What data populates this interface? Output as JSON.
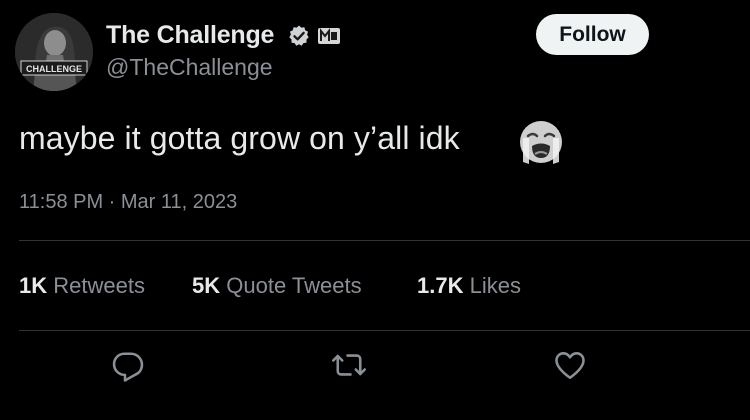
{
  "account": {
    "display_name": "The Challenge",
    "handle": "@TheChallenge",
    "avatar_text": "CHALLENGE",
    "verified_icon": "verified-badge-icon",
    "affiliate_icon": "affiliate-badge-icon"
  },
  "follow_button": {
    "label": "Follow"
  },
  "tweet": {
    "text": "maybe it gotta grow on y’all idk",
    "emoji": "loudly-crying-face",
    "timestamp": "11:58 PM · Mar 11, 2023"
  },
  "stats": [
    {
      "value": "1K",
      "label": "Retweets"
    },
    {
      "value": "5K",
      "label": "Quote Tweets"
    },
    {
      "value": "1.7K",
      "label": "Likes"
    }
  ],
  "actions": [
    {
      "icon": "reply-icon"
    },
    {
      "icon": "retweet-icon"
    },
    {
      "icon": "like-icon"
    }
  ],
  "colors": {
    "background": "#000000",
    "primary_text": "#e7e9ea",
    "secondary_text": "#8b9096",
    "divider": "#2f3336",
    "button_bg": "#eff3f4"
  }
}
